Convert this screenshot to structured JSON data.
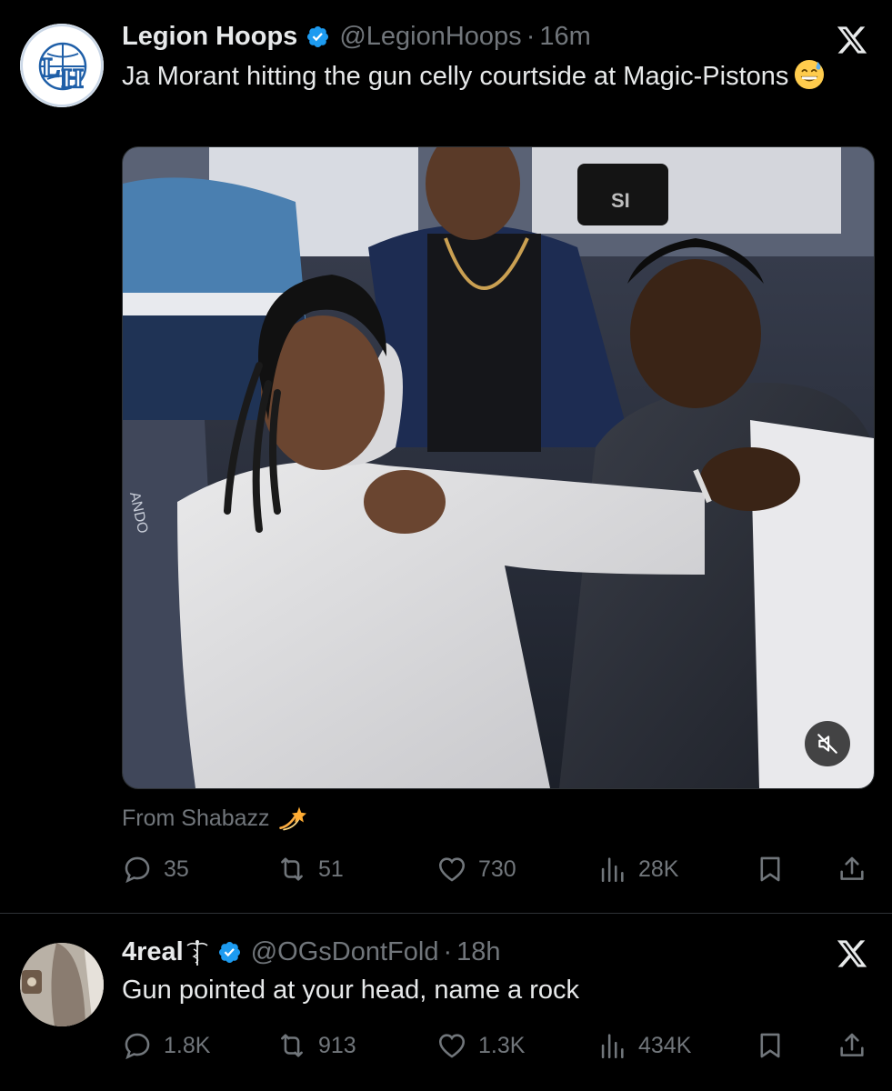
{
  "tweets": [
    {
      "display_name": "Legion Hoops",
      "handle": "@LegionHoops",
      "separator": "·",
      "time": "16m",
      "text": "Ja Morant hitting the gun celly courtside at Magic-Pistons",
      "text_emoji": "grinning-face-with-sweat-emoji",
      "media": {
        "type": "video",
        "sound": "muted",
        "seat_text": "ANDO",
        "placard_text": "SI"
      },
      "attribution": "From Shabazz",
      "attribution_emoji": "dizzy-emoji",
      "stats": {
        "replies": "35",
        "reposts": "51",
        "likes": "730",
        "views": "28K"
      }
    },
    {
      "display_name": "4real",
      "handle": "@OGsDontFold",
      "separator": "·",
      "time": "18h",
      "text": "Gun pointed at your head, name a rock",
      "stats": {
        "replies": "1.8K",
        "reposts": "913",
        "likes": "1.3K",
        "views": "434K"
      }
    }
  ],
  "avatar_logo_text": "LH",
  "colors": {
    "background": "#000000",
    "text_primary": "#e7e9ea",
    "text_secondary": "#71767b",
    "verified_blue": "#1d9bf0",
    "divider": "#2f3336"
  },
  "icons": [
    "reply-icon",
    "repost-icon",
    "like-icon",
    "views-icon",
    "bookmark-icon",
    "share-icon",
    "x-logo-icon",
    "verified-badge-icon",
    "mute-icon"
  ]
}
